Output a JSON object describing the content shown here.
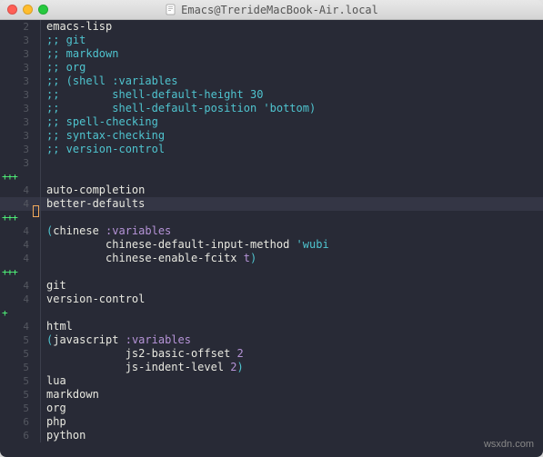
{
  "window": {
    "title": "Emacs@TrerideMacBook-Air.local",
    "icon": "document-icon"
  },
  "watermark": "wsxdn.com",
  "lines": [
    {
      "diff": "",
      "num": "2",
      "cursor": false,
      "current": false,
      "tokens": [
        {
          "cls": "c-normal",
          "t": "emacs-lisp"
        }
      ]
    },
    {
      "diff": "",
      "num": "3",
      "cursor": false,
      "current": false,
      "tokens": [
        {
          "cls": "c-comment",
          "t": ";; git"
        }
      ]
    },
    {
      "diff": "",
      "num": "3",
      "cursor": false,
      "current": false,
      "tokens": [
        {
          "cls": "c-comment",
          "t": ";; markdown"
        }
      ]
    },
    {
      "diff": "",
      "num": "3",
      "cursor": false,
      "current": false,
      "tokens": [
        {
          "cls": "c-comment",
          "t": ";; org"
        }
      ]
    },
    {
      "diff": "",
      "num": "3",
      "cursor": false,
      "current": false,
      "tokens": [
        {
          "cls": "c-comment",
          "t": ";; (shell :variables"
        }
      ]
    },
    {
      "diff": "",
      "num": "3",
      "cursor": false,
      "current": false,
      "tokens": [
        {
          "cls": "c-comment",
          "t": ";;        shell-default-height 30"
        }
      ]
    },
    {
      "diff": "",
      "num": "3",
      "cursor": false,
      "current": false,
      "tokens": [
        {
          "cls": "c-comment",
          "t": ";;        shell-default-position 'bottom)"
        }
      ]
    },
    {
      "diff": "",
      "num": "3",
      "cursor": false,
      "current": false,
      "tokens": [
        {
          "cls": "c-comment",
          "t": ";; spell-checking"
        }
      ]
    },
    {
      "diff": "",
      "num": "3",
      "cursor": false,
      "current": false,
      "tokens": [
        {
          "cls": "c-comment",
          "t": ";; syntax-checking"
        }
      ]
    },
    {
      "diff": "",
      "num": "3",
      "cursor": false,
      "current": false,
      "tokens": [
        {
          "cls": "c-comment",
          "t": ";; version-control"
        }
      ]
    },
    {
      "diff": "",
      "num": "3",
      "cursor": false,
      "current": false,
      "tokens": []
    },
    {
      "diff": "+++",
      "num": "",
      "cursor": false,
      "current": false,
      "tokens": []
    },
    {
      "diff": "",
      "num": "4",
      "cursor": false,
      "current": false,
      "tokens": [
        {
          "cls": "c-normal",
          "t": "auto-completion"
        }
      ]
    },
    {
      "diff": "",
      "num": "4",
      "cursor": true,
      "current": true,
      "tokens": [
        {
          "cls": "c-normal",
          "t": "better-defaults"
        }
      ]
    },
    {
      "diff": "+++",
      "num": "",
      "cursor": false,
      "current": false,
      "tokens": []
    },
    {
      "diff": "",
      "num": "4",
      "cursor": false,
      "current": false,
      "tokens": [
        {
          "cls": "c-paren",
          "t": "("
        },
        {
          "cls": "c-normal",
          "t": "chinese "
        },
        {
          "cls": "c-keyword",
          "t": ":variables"
        }
      ]
    },
    {
      "diff": "",
      "num": "4",
      "cursor": false,
      "current": false,
      "tokens": [
        {
          "cls": "c-normal",
          "t": "         chinese-default-input-method "
        },
        {
          "cls": "c-symbol",
          "t": "'wubi"
        }
      ]
    },
    {
      "diff": "",
      "num": "4",
      "cursor": false,
      "current": false,
      "tokens": [
        {
          "cls": "c-normal",
          "t": "         chinese-enable-fcitx "
        },
        {
          "cls": "c-keyword-bold",
          "t": "t"
        },
        {
          "cls": "c-paren",
          "t": ")"
        }
      ]
    },
    {
      "diff": "+++",
      "num": "",
      "cursor": false,
      "current": false,
      "tokens": []
    },
    {
      "diff": "",
      "num": "4",
      "cursor": false,
      "current": false,
      "tokens": [
        {
          "cls": "c-normal",
          "t": "git"
        }
      ]
    },
    {
      "diff": "",
      "num": "4",
      "cursor": false,
      "current": false,
      "tokens": [
        {
          "cls": "c-normal",
          "t": "version-control"
        }
      ]
    },
    {
      "diff": "+",
      "num": "",
      "cursor": false,
      "current": false,
      "tokens": []
    },
    {
      "diff": "",
      "num": "4",
      "cursor": false,
      "current": false,
      "tokens": [
        {
          "cls": "c-normal",
          "t": "html"
        }
      ]
    },
    {
      "diff": "",
      "num": "5",
      "cursor": false,
      "current": false,
      "tokens": [
        {
          "cls": "c-paren",
          "t": "("
        },
        {
          "cls": "c-normal",
          "t": "javascript "
        },
        {
          "cls": "c-keyword",
          "t": ":variables"
        }
      ]
    },
    {
      "diff": "",
      "num": "5",
      "cursor": false,
      "current": false,
      "tokens": [
        {
          "cls": "c-normal",
          "t": "            js2-basic-offset "
        },
        {
          "cls": "c-number",
          "t": "2"
        }
      ]
    },
    {
      "diff": "",
      "num": "5",
      "cursor": false,
      "current": false,
      "tokens": [
        {
          "cls": "c-normal",
          "t": "            js-indent-level "
        },
        {
          "cls": "c-number",
          "t": "2"
        },
        {
          "cls": "c-paren",
          "t": ")"
        }
      ]
    },
    {
      "diff": "",
      "num": "5",
      "cursor": false,
      "current": false,
      "tokens": [
        {
          "cls": "c-normal",
          "t": "lua"
        }
      ]
    },
    {
      "diff": "",
      "num": "5",
      "cursor": false,
      "current": false,
      "tokens": [
        {
          "cls": "c-normal",
          "t": "markdown"
        }
      ]
    },
    {
      "diff": "",
      "num": "5",
      "cursor": false,
      "current": false,
      "tokens": [
        {
          "cls": "c-normal",
          "t": "org"
        }
      ]
    },
    {
      "diff": "",
      "num": "6",
      "cursor": false,
      "current": false,
      "tokens": [
        {
          "cls": "c-normal",
          "t": "php"
        }
      ]
    },
    {
      "diff": "",
      "num": "6",
      "cursor": false,
      "current": false,
      "tokens": [
        {
          "cls": "c-normal",
          "t": "python"
        }
      ]
    }
  ]
}
